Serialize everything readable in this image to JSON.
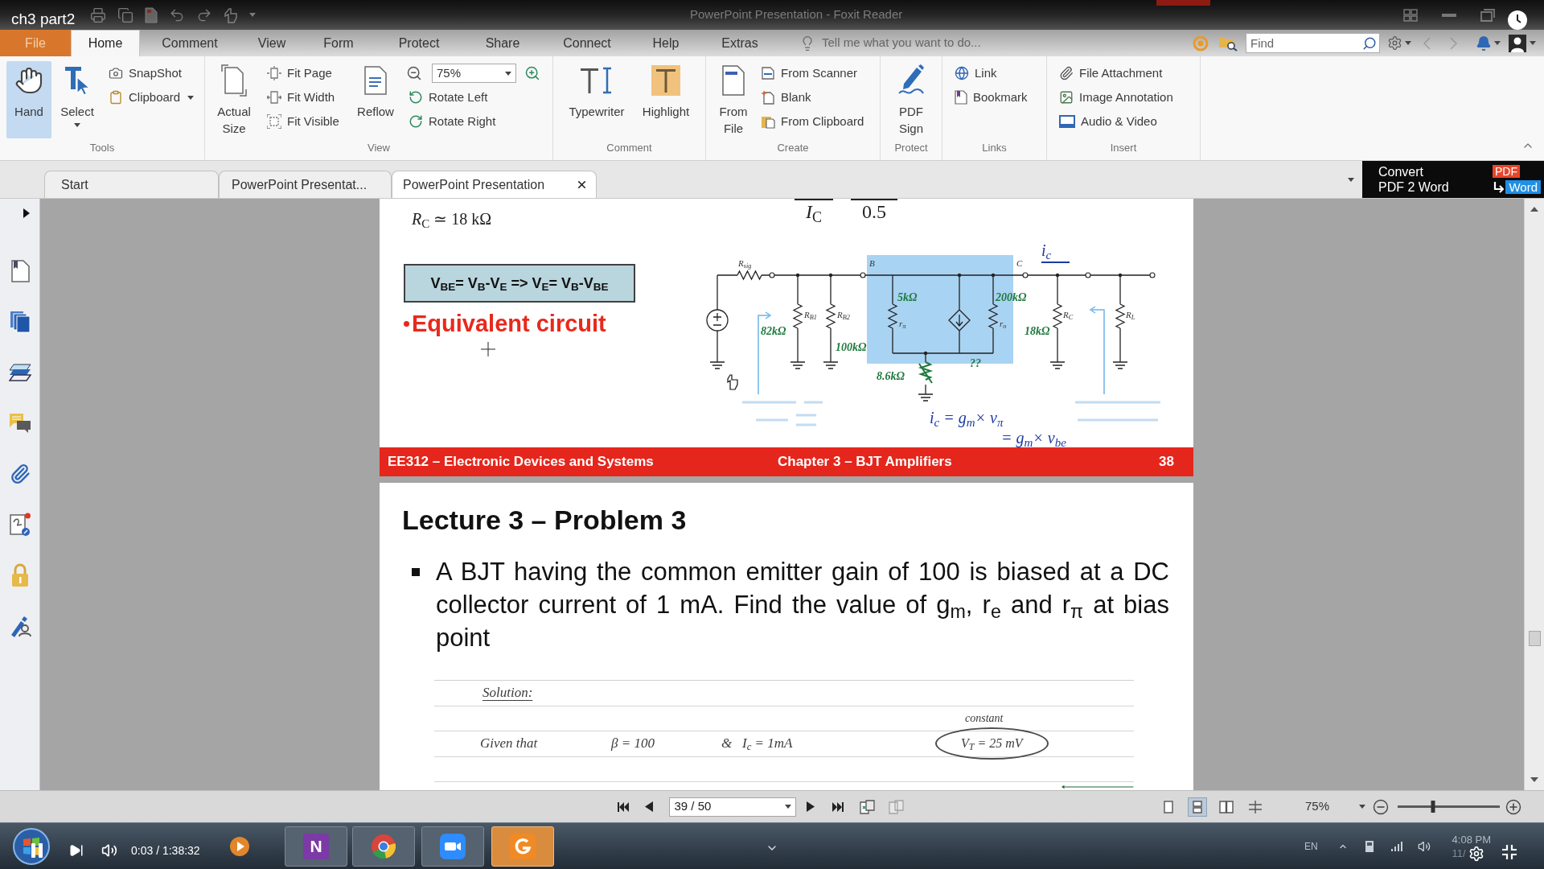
{
  "player": {
    "title": "ch3 part2",
    "playing": true,
    "time": "0:03 / 1:38:32"
  },
  "window": {
    "title": "PowerPoint Presentation - Foxit Reader"
  },
  "menu_tabs": [
    {
      "label": "File",
      "kind": "file",
      "selected": false
    },
    {
      "label": "Home",
      "kind": "tab",
      "selected": true
    },
    {
      "label": "Comment",
      "kind": "tab",
      "selected": false
    },
    {
      "label": "View",
      "kind": "tab",
      "selected": false
    },
    {
      "label": "Form",
      "kind": "tab",
      "selected": false
    },
    {
      "label": "Protect",
      "kind": "tab",
      "selected": false
    },
    {
      "label": "Share",
      "kind": "tab",
      "selected": false
    },
    {
      "label": "Connect",
      "kind": "tab",
      "selected": false
    },
    {
      "label": "Help",
      "kind": "tab",
      "selected": false
    },
    {
      "label": "Extras",
      "kind": "tab",
      "selected": false
    }
  ],
  "tell_me": {
    "placeholder": "Tell me what you want to do..."
  },
  "find": {
    "placeholder": "Find"
  },
  "ribbon": {
    "groups": [
      {
        "label": "Tools",
        "items": [
          {
            "label": "Hand",
            "selected": true
          },
          {
            "label": "Select",
            "selected": false
          },
          {
            "label": "SnapShot",
            "selected": false
          },
          {
            "label": "Clipboard",
            "selected": false
          }
        ]
      },
      {
        "label": "View",
        "items": [
          "Actual Size",
          "Fit Page",
          "Fit Width",
          "Fit Visible",
          "Reflow",
          "Rotate Left",
          "Rotate Right"
        ],
        "zoom": "75%"
      },
      {
        "label": "Comment",
        "items": [
          "Typewriter",
          "Highlight"
        ]
      },
      {
        "label": "Create",
        "items": [
          "From File",
          "From Scanner",
          "Blank",
          "From Clipboard"
        ]
      },
      {
        "label": "Protect",
        "items": [
          "PDF Sign"
        ]
      },
      {
        "label": "Links",
        "items": [
          "Link",
          "Bookmark"
        ]
      },
      {
        "label": "Insert",
        "items": [
          "File Attachment",
          "Image Annotation",
          "Audio & Video"
        ]
      }
    ]
  },
  "doc_tabs": [
    {
      "label": "Start",
      "selected": false
    },
    {
      "label": "PowerPoint Presentat...",
      "selected": false
    },
    {
      "label": "PowerPoint Presentation",
      "selected": true
    }
  ],
  "convert_banner": {
    "title": "Convert",
    "subtitle": "PDF 2 Word",
    "from": "PDF",
    "to": "Word"
  },
  "upper_page": {
    "formula_fragments": [
      "*I*$_{C}$",
      "0.5"
    ],
    "rc_note": "*R*$_{C}$ ≃ 18 kΩ",
    "equation": "V$_{BE}$= V$_{B}$-V$_{E}$ => V$_{E}$= V$_{B}$-V$_{BE}$",
    "heading": "Equivalent circuit",
    "circuit_labels": [
      {
        "kind": "label",
        "text": "R$_{sig}$"
      },
      {
        "kind": "label",
        "text": "R$_{B1}$"
      },
      {
        "kind": "label",
        "text": "R$_{B2}$"
      },
      {
        "kind": "label",
        "text": "r$_{π}$"
      },
      {
        "kind": "label",
        "text": "r$_{o}$"
      },
      {
        "kind": "label",
        "text": "R$_{C}$"
      },
      {
        "kind": "label",
        "text": "R$_{L}$"
      },
      {
        "kind": "label",
        "text": "B"
      },
      {
        "kind": "label",
        "text": "C"
      },
      {
        "kind": "value",
        "text": "82kΩ"
      },
      {
        "kind": "value",
        "text": "100kΩ"
      },
      {
        "kind": "value",
        "text": "5kΩ"
      },
      {
        "kind": "value",
        "text": "200kΩ"
      },
      {
        "kind": "value",
        "text": "18kΩ"
      },
      {
        "kind": "value",
        "text": "8.6kΩ"
      },
      {
        "kind": "value",
        "text": "??"
      },
      {
        "kind": "formula",
        "text": "i$_{c}$"
      },
      {
        "kind": "formula",
        "text": "i$_{c}$ = g$_{m}$× v$_{π}$"
      },
      {
        "kind": "formula",
        "text": "= g$_{m}$× v$_{be}$"
      }
    ],
    "footer": {
      "course": "EE312 – Electronic Devices and Systems",
      "chapter": "Chapter 3 – BJT Amplifiers",
      "page": "38"
    }
  },
  "lower_page": {
    "title": "Lecture 3 – Problem 3",
    "problem": "A BJT having the common emitter gain of 100 is biased at a DC collector current of 1 mA. Find the value of g$_{m}$, r$_{e}$ and r$_{π}$ at bias point",
    "notes": [
      {
        "items": [
          {
            "kind": "underlined",
            "text": "Solution:"
          }
        ]
      },
      {
        "items": [
          {
            "kind": "small",
            "text": "constant"
          }
        ]
      },
      {
        "items": [
          {
            "kind": "plain",
            "text": "Given that"
          },
          {
            "kind": "plain",
            "text": "β = 100"
          },
          {
            "kind": "plain",
            "text": "&"
          },
          {
            "kind": "plain",
            "text": "I$_{c}$ = 1mA"
          },
          {
            "kind": "circled",
            "text": "V$_{T}$ = 25 mV"
          }
        ]
      }
    ]
  },
  "nav_bar": {
    "page": "39 / 50",
    "view_modes": [
      {
        "selected": false
      },
      {
        "selected": true
      },
      {
        "selected": false
      },
      {
        "selected": false
      }
    ],
    "zoom": "75%"
  },
  "zoom_slider": {
    "level": 0.35
  },
  "taskbar": {
    "apps": [
      {
        "selected": false
      },
      {
        "label": "N",
        "selected": false
      },
      {
        "selected": false
      },
      {
        "selected": false
      },
      {
        "selected": true
      }
    ],
    "language": "EN",
    "time": "4:08 PM",
    "date": "11/"
  }
}
